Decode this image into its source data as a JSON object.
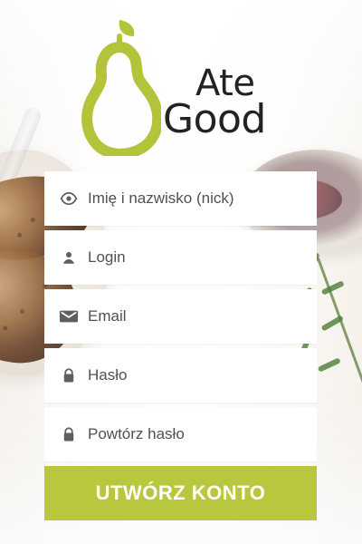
{
  "app": {
    "brand": {
      "top": "Ate",
      "bottom": "Good"
    },
    "colors": {
      "accent": "#b8c73e",
      "field_bg": "#ffffff",
      "text": "#505050",
      "icon": "#5f5f5f",
      "brand_text": "#222222",
      "pear_green": "#b3c43a",
      "pear_leaf": "#b3c43a"
    },
    "icons": {
      "name_field": "eye-icon",
      "login_field": "user-icon",
      "email_field": "envelope-icon",
      "password_field": "lock-icon",
      "repeat_password_field": "lock-icon"
    }
  },
  "form": {
    "fields": [
      {
        "key": "nick",
        "placeholder": "Imię i nazwisko (nick)",
        "value": ""
      },
      {
        "key": "login",
        "placeholder": "Login",
        "value": ""
      },
      {
        "key": "email",
        "placeholder": "Email",
        "value": ""
      },
      {
        "key": "password",
        "placeholder": "Hasło",
        "value": ""
      },
      {
        "key": "repeat_password",
        "placeholder": "Powtórz hasło",
        "value": ""
      }
    ],
    "submit_label": "UTWÓRZ KONTO"
  }
}
